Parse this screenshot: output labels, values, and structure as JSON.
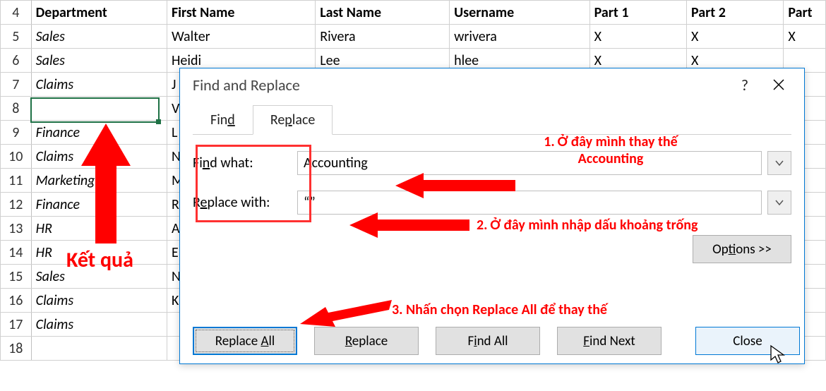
{
  "sheet": {
    "headers": [
      "Department",
      "First Name",
      "Last Name",
      "Username",
      "Part 1",
      "Part 2",
      "Part"
    ],
    "rownums": [
      "4",
      "5",
      "6",
      "7",
      "8",
      "9",
      "10",
      "11",
      "12",
      "13",
      "14",
      "15",
      "16",
      "17",
      "18"
    ],
    "rows": [
      {
        "dept": "Sales",
        "first": "Walter",
        "last": "Rivera",
        "user": "wrivera",
        "p1": "X",
        "p2": "X",
        "p3": "X"
      },
      {
        "dept": "Sales",
        "first": "Heidi",
        "last": "Lee",
        "user": "hlee",
        "p1": "X",
        "p2": "X",
        "p3": ""
      },
      {
        "dept": "Claims",
        "first": "J",
        "last": "",
        "user": "",
        "p1": "",
        "p2": "",
        "p3": ""
      },
      {
        "dept": "",
        "first": "V",
        "last": "",
        "user": "",
        "p1": "",
        "p2": "",
        "p3": ""
      },
      {
        "dept": "Finance",
        "first": "L",
        "last": "",
        "user": "",
        "p1": "",
        "p2": "",
        "p3": ""
      },
      {
        "dept": "Claims",
        "first": "N",
        "last": "",
        "user": "",
        "p1": "",
        "p2": "",
        "p3": ""
      },
      {
        "dept": "Marketing",
        "first": "M",
        "last": "",
        "user": "",
        "p1": "",
        "p2": "",
        "p3": ""
      },
      {
        "dept": "Finance",
        "first": "R",
        "last": "",
        "user": "",
        "p1": "",
        "p2": "",
        "p3": ""
      },
      {
        "dept": "HR",
        "first": "A",
        "last": "",
        "user": "",
        "p1": "",
        "p2": "",
        "p3": ""
      },
      {
        "dept": "HR",
        "first": "E",
        "last": "",
        "user": "",
        "p1": "",
        "p2": "",
        "p3": ""
      },
      {
        "dept": "Sales",
        "first": "N",
        "last": "",
        "user": "",
        "p1": "",
        "p2": "",
        "p3": ""
      },
      {
        "dept": "Claims",
        "first": "K",
        "last": "",
        "user": "",
        "p1": "",
        "p2": "",
        "p3": ""
      },
      {
        "dept": "Claims",
        "first": "",
        "last": "",
        "user": "",
        "p1": "",
        "p2": "",
        "p3": ""
      },
      {
        "dept": "",
        "first": "",
        "last": "",
        "user": "",
        "p1": "",
        "p2": "",
        "p3": ""
      }
    ]
  },
  "result_label": "Kết quả",
  "dialog": {
    "title": "Find and Replace",
    "tab_find": "Find",
    "tab_replace": "Replace",
    "find_what_label_pre": "Fi",
    "find_what_label_u": "n",
    "find_what_label_post": "d what:",
    "replace_with_label_pre": "R",
    "replace_with_label_u": "e",
    "replace_with_label_post": "place with:",
    "find_value": "Accounting",
    "replace_value": "“”",
    "options_pre": "Op",
    "options_u": "t",
    "options_post": "ions >>",
    "btn_replace_all_pre": "Replace ",
    "btn_replace_all_u": "A",
    "btn_replace_all_post": "ll",
    "btn_replace_u": "R",
    "btn_replace_post": "eplace",
    "btn_find_all_pre": "F",
    "btn_find_all_u": "i",
    "btn_find_all_post": "nd All",
    "btn_find_next_u": "F",
    "btn_find_next_post": "ind Next",
    "btn_close": "Close"
  },
  "callouts": {
    "c1a": "1. Ở đây mình thay thế",
    "c1b": "Accounting",
    "c2": "2. Ở đây mình nhập dấu khoảng trống",
    "c3": "3. Nhấn chọn Replace All để thay thế"
  }
}
